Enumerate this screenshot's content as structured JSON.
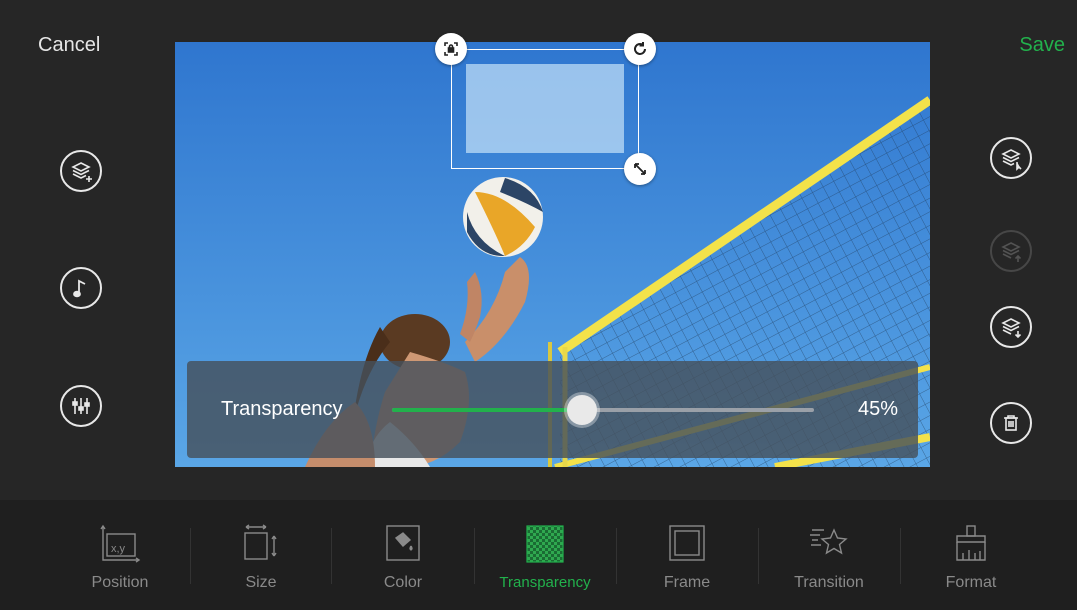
{
  "topbar": {
    "cancel_label": "Cancel",
    "save_label": "Save"
  },
  "left_actions": [
    {
      "name": "add-layer",
      "icon": "layers-add-icon"
    },
    {
      "name": "music",
      "icon": "music-note-icon"
    },
    {
      "name": "adjust",
      "icon": "sliders-icon"
    }
  ],
  "right_actions": [
    {
      "name": "select-layer",
      "icon": "layers-select-icon",
      "enabled": true
    },
    {
      "name": "layer-up",
      "icon": "layer-up-icon",
      "enabled": false
    },
    {
      "name": "layer-down",
      "icon": "layer-down-icon",
      "enabled": true
    },
    {
      "name": "delete",
      "icon": "trash-icon",
      "enabled": true
    }
  ],
  "transparency": {
    "label": "Transparency",
    "value": 45,
    "value_text": "45%"
  },
  "toolbar": {
    "tabs": [
      {
        "label": "Position",
        "icon": "position-xy-icon"
      },
      {
        "label": "Size",
        "icon": "resize-icon"
      },
      {
        "label": "Color",
        "icon": "paint-bucket-icon"
      },
      {
        "label": "Transparency",
        "icon": "checkerboard-icon",
        "active": true
      },
      {
        "label": "Frame",
        "icon": "frame-icon"
      },
      {
        "label": "Transition",
        "icon": "star-motion-icon"
      },
      {
        "label": "Format",
        "icon": "brush-icon"
      }
    ],
    "position_icon_text": "x,y"
  },
  "colors": {
    "accent": "#22b14c",
    "background": "#262626",
    "toolbar": "#1f1f1f"
  }
}
